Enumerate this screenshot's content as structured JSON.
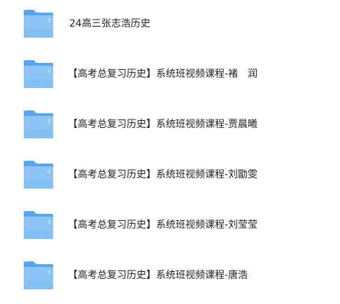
{
  "files": [
    {
      "name": "24高三张志浩历史",
      "icon": "folder-icon"
    },
    {
      "name": "【高考总复习历史】系统班视频课程-褚　润",
      "icon": "folder-icon"
    },
    {
      "name": "【高考总复习历史】系统班视频课程-贾晨曦",
      "icon": "folder-icon"
    },
    {
      "name": "【高考总复习历史】系统班视频课程-刘勖雯",
      "icon": "folder-icon"
    },
    {
      "name": "【高考总复习历史】系统班视频课程-刘莹莹",
      "icon": "folder-icon"
    },
    {
      "name": "【高考总复习历史】系统班视频课程-唐浩",
      "icon": "folder-icon"
    }
  ],
  "colors": {
    "folder_back": "#5aa6ec",
    "folder_front": "#8cc6f7",
    "folder_front_bottom": "#6fb3f2",
    "text": "#1f1f1f"
  }
}
